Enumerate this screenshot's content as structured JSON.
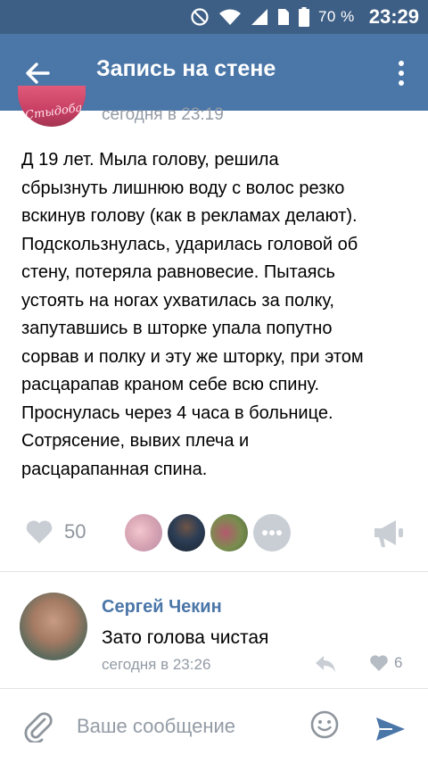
{
  "status_bar": {
    "battery": "70 %",
    "time": "23:29",
    "icons": [
      "dnd-icon",
      "wifi-icon",
      "signal-icon",
      "sim-icon",
      "battery-icon"
    ]
  },
  "header": {
    "title": "Запись на стене",
    "back_icon": "arrow-left-icon",
    "menu_icon": "more-vertical-icon"
  },
  "post": {
    "avatar_text": "Стыдоба",
    "time": "сегодня в 23:19",
    "text": "Д 19 лет. Мыла голову, решила\nсбрызнуть лишнюю воду с волос резко\nвскинув голову (как в рекламах делают).\nПодскользнулась, ударилась головой об\nстену, потеряла равновесие. Пытаясь\nустоять на ногах ухватилась за полку,\nзапутавшись в шторке упала попутно\nсорвав и полку и эту же шторку, при этом\nрасцарапав краном себе всю спину.\nПроснулась через 4 часа в больнице.\nСотрясение, вывих плеча и\nрасцарапанная спина.",
    "likes": "50"
  },
  "comment": {
    "author": "Сергей Чекин",
    "text": "Зато голова чистая",
    "time": "сегодня в 23:26",
    "likes": "6"
  },
  "composer": {
    "placeholder": "Ваше сообщение"
  },
  "colors": {
    "status_bar": "#3e5f85",
    "app_bar": "#4a76a8",
    "link": "#4a76a8",
    "secondary_text": "#939ba5",
    "icon_gray": "#c9ced5"
  }
}
